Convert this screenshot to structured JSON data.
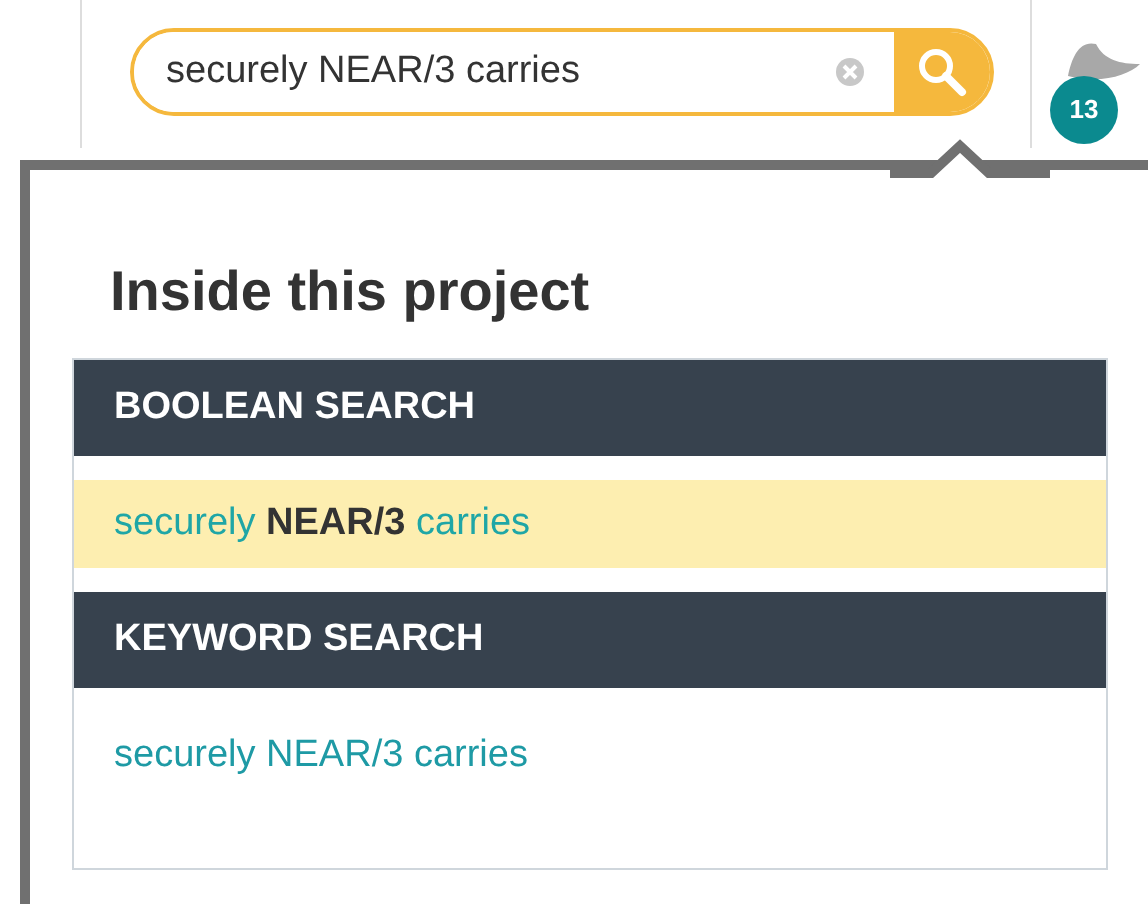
{
  "search": {
    "value": "securely NEAR/3 carries"
  },
  "notification_count": "13",
  "dropdown": {
    "title": "Inside this project",
    "sections": [
      {
        "heading": "BOOLEAN SEARCH",
        "results": [
          {
            "text": "securely **NEAR/3** carries",
            "selected": true
          }
        ]
      },
      {
        "heading": "KEYWORD SEARCH",
        "results": [
          {
            "text": "securely NEAR/3 carries",
            "selected": false
          }
        ]
      }
    ]
  }
}
